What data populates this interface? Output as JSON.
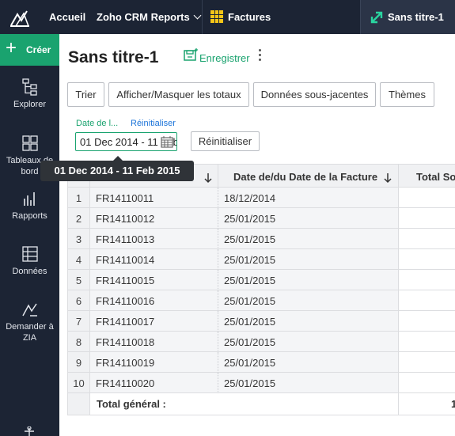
{
  "topbar": {
    "home": "Accueil",
    "workspace": "Zoho CRM Reports",
    "table_tab": "Factures",
    "active_tab": "Sans titre-1"
  },
  "sidebar": {
    "create": "Créer",
    "items": [
      {
        "label": "Explorer",
        "icon": "explorer-icon"
      },
      {
        "label": "Tableaux de bord",
        "icon": "dashboard-icon"
      },
      {
        "label": "Rapports",
        "icon": "reports-icon"
      },
      {
        "label": "Données",
        "icon": "data-icon"
      },
      {
        "label": "Demander à ZIA",
        "icon": "zia-icon"
      }
    ]
  },
  "report": {
    "title": "Sans titre-1",
    "save": "Enregistrer"
  },
  "toolbar": {
    "sort": "Trier",
    "totals": "Afficher/Masquer les totaux",
    "underlying": "Données sous-jacentes",
    "themes": "Thèmes"
  },
  "filter": {
    "label": "Date de l...",
    "reset_link": "Réinitialiser",
    "value": "01 Dec 2014 - 11 Feb 2015",
    "reset_button": "Réinitialiser",
    "tooltip": "01 Dec 2014 - 11 Feb 2015"
  },
  "table": {
    "columns": [
      "",
      "Date de/du Date de la Facture",
      "Total So"
    ],
    "rows": [
      {
        "n": "1",
        "id": "FR14110011",
        "date": "18/12/2014"
      },
      {
        "n": "2",
        "id": "FR14110012",
        "date": "25/01/2015"
      },
      {
        "n": "3",
        "id": "FR14110013",
        "date": "25/01/2015"
      },
      {
        "n": "4",
        "id": "FR14110014",
        "date": "25/01/2015"
      },
      {
        "n": "5",
        "id": "FR14110015",
        "date": "25/01/2015"
      },
      {
        "n": "6",
        "id": "FR14110016",
        "date": "25/01/2015"
      },
      {
        "n": "7",
        "id": "FR14110017",
        "date": "25/01/2015"
      },
      {
        "n": "8",
        "id": "FR14110018",
        "date": "25/01/2015"
      },
      {
        "n": "9",
        "id": "FR14110019",
        "date": "25/01/2015"
      },
      {
        "n": "10",
        "id": "FR14110020",
        "date": "25/01/2015"
      }
    ],
    "grand_total_label": "Total général :",
    "grand_total_value": "1"
  },
  "colors": {
    "sidebar_bg": "#1c2434",
    "accent_green": "#1aa36f",
    "link_blue": "#1a73d9",
    "factures_icon": "#f5c518"
  }
}
